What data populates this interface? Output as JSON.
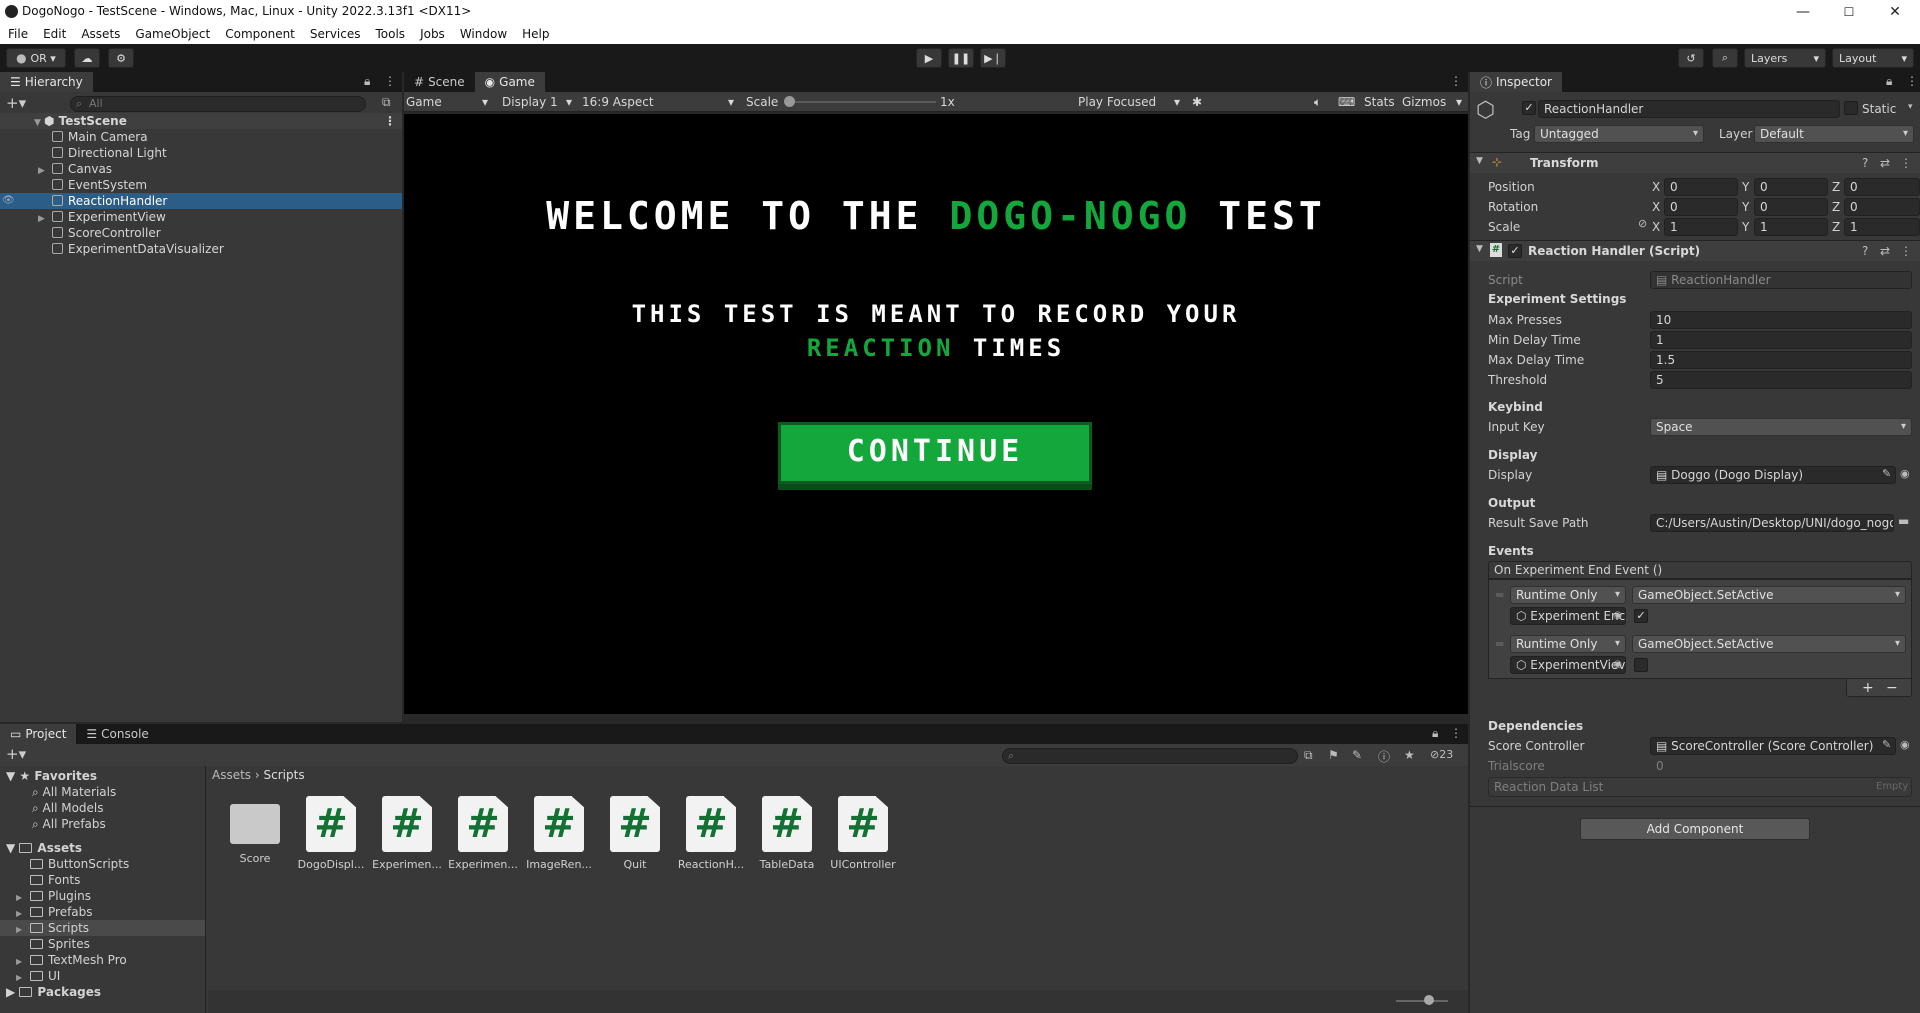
{
  "window": {
    "title": "DogoNogo - TestScene - Windows, Mac, Linux - Unity 2022.3.13f1 <DX11>",
    "minimize": "—",
    "maximize": "☐",
    "close": "✕"
  },
  "menu": [
    "File",
    "Edit",
    "Assets",
    "GameObject",
    "Component",
    "Services",
    "Tools",
    "Jobs",
    "Window",
    "Help"
  ],
  "toolbar": {
    "account": "OR",
    "layers": "Layers",
    "layout": "Layout"
  },
  "hierarchy": {
    "tab": "Hierarchy",
    "search_placeholder": "All",
    "scene": "TestScene",
    "items": [
      {
        "label": "Main Camera",
        "expandable": false,
        "selected": false
      },
      {
        "label": "Directional Light",
        "expandable": false,
        "selected": false
      },
      {
        "label": "Canvas",
        "expandable": true,
        "selected": false
      },
      {
        "label": "EventSystem",
        "expandable": false,
        "selected": false
      },
      {
        "label": "ReactionHandler",
        "expandable": false,
        "selected": true
      },
      {
        "label": "ExperimentView",
        "expandable": true,
        "selected": false
      },
      {
        "label": "ScoreController",
        "expandable": false,
        "selected": false
      },
      {
        "label": "ExperimentDataVisualizer",
        "expandable": false,
        "selected": false
      }
    ]
  },
  "game": {
    "tabs": [
      {
        "label": "Scene"
      },
      {
        "label": "Game"
      }
    ],
    "view_mode": "Game",
    "display": "Display 1",
    "aspect": "16:9 Aspect",
    "scale_label": "Scale",
    "scale_value": "1x",
    "play_mode": "Play Focused",
    "stats": "Stats",
    "gizmos": "Gizmos",
    "heading_part1": "WELCOME TO THE",
    "heading_highlight": "DOGO-NOGO",
    "heading_part2": "TEST",
    "subtitle_line1": "THIS TEST IS MEANT TO RECORD YOUR",
    "subtitle_highlight": "REACTION",
    "subtitle_line2": "TIMES",
    "continue_label": "CONTINUE",
    "accent_color": "#14a83c"
  },
  "inspector": {
    "tab": "Inspector",
    "object_name": "ReactionHandler",
    "static_label": "Static",
    "tag_label": "Tag",
    "tag_value": "Untagged",
    "layer_label": "Layer",
    "layer_value": "Default",
    "transform": {
      "title": "Transform",
      "position_label": "Position",
      "rotation_label": "Rotation",
      "scale_label": "Scale",
      "position": [
        "0",
        "0",
        "0"
      ],
      "rotation": [
        "0",
        "0",
        "0"
      ],
      "scale": [
        "1",
        "1",
        "1"
      ],
      "axes": [
        "X",
        "Y",
        "Z"
      ]
    },
    "component": {
      "title": "Reaction Handler (Script)",
      "script_label": "Script",
      "script_value": "ReactionHandler",
      "experiment_settings": "Experiment Settings",
      "max_presses_label": "Max Presses",
      "max_presses": "10",
      "min_delay_label": "Min Delay Time",
      "min_delay": "1",
      "max_delay_label": "Max Delay Time",
      "max_delay": "1.5",
      "threshold_label": "Threshold",
      "threshold": "5",
      "keybind": "Keybind",
      "input_key_label": "Input Key",
      "input_key": "Space",
      "display_header": "Display",
      "display_label": "Display",
      "display_value": "Doggo (Dogo Display)",
      "output": "Output",
      "result_path_label": "Result Save Path",
      "result_path": "C:/Users/Austin/Desktop/UNI/dogo_nogo/r",
      "events": "Events",
      "event_name": "On Experiment End Event ()",
      "listeners": [
        {
          "mode": "Runtime Only",
          "function": "GameObject.SetActive",
          "target": "Experiment Enc",
          "checked": true
        },
        {
          "mode": "Runtime Only",
          "function": "GameObject.SetActive",
          "target": "ExperimentViev",
          "checked": false
        }
      ],
      "add": "+",
      "remove": "−",
      "dependencies": "Dependencies",
      "score_controller_label": "Score Controller",
      "score_controller": "ScoreController (Score Controller)",
      "trialscore_label": "Trialscore",
      "trialscore": "0",
      "reaction_list_label": "Reaction Data List",
      "reaction_list_value": "Empty"
    },
    "add_component": "Add Component"
  },
  "project": {
    "tabs": [
      {
        "label": "Project"
      },
      {
        "label": "Console"
      }
    ],
    "favorites": "Favorites",
    "favorite_items": [
      "All Materials",
      "All Models",
      "All Prefabs"
    ],
    "assets_root": "Assets",
    "folders": [
      {
        "label": "ButtonScripts",
        "expandable": false,
        "selected": false
      },
      {
        "label": "Fonts",
        "expandable": false,
        "selected": false
      },
      {
        "label": "Plugins",
        "expandable": true,
        "selected": false
      },
      {
        "label": "Prefabs",
        "expandable": true,
        "selected": false
      },
      {
        "label": "Scripts",
        "expandable": true,
        "selected": true
      },
      {
        "label": "Sprites",
        "expandable": false,
        "selected": false
      },
      {
        "label": "TextMesh Pro",
        "expandable": true,
        "selected": false
      },
      {
        "label": "UI",
        "expandable": true,
        "selected": false
      }
    ],
    "packages": "Packages",
    "breadcrumb": [
      "Assets",
      "Scripts"
    ],
    "hidden_count": "23",
    "assets": [
      {
        "name": "Score",
        "kind": "folder"
      },
      {
        "name": "DogoDispl...",
        "kind": "script"
      },
      {
        "name": "Experimen...",
        "kind": "script"
      },
      {
        "name": "Experimen...",
        "kind": "script"
      },
      {
        "name": "ImageRen...",
        "kind": "script"
      },
      {
        "name": "Quit",
        "kind": "script"
      },
      {
        "name": "ReactionH...",
        "kind": "script"
      },
      {
        "name": "TableData",
        "kind": "script"
      },
      {
        "name": "UIController",
        "kind": "script"
      }
    ]
  }
}
